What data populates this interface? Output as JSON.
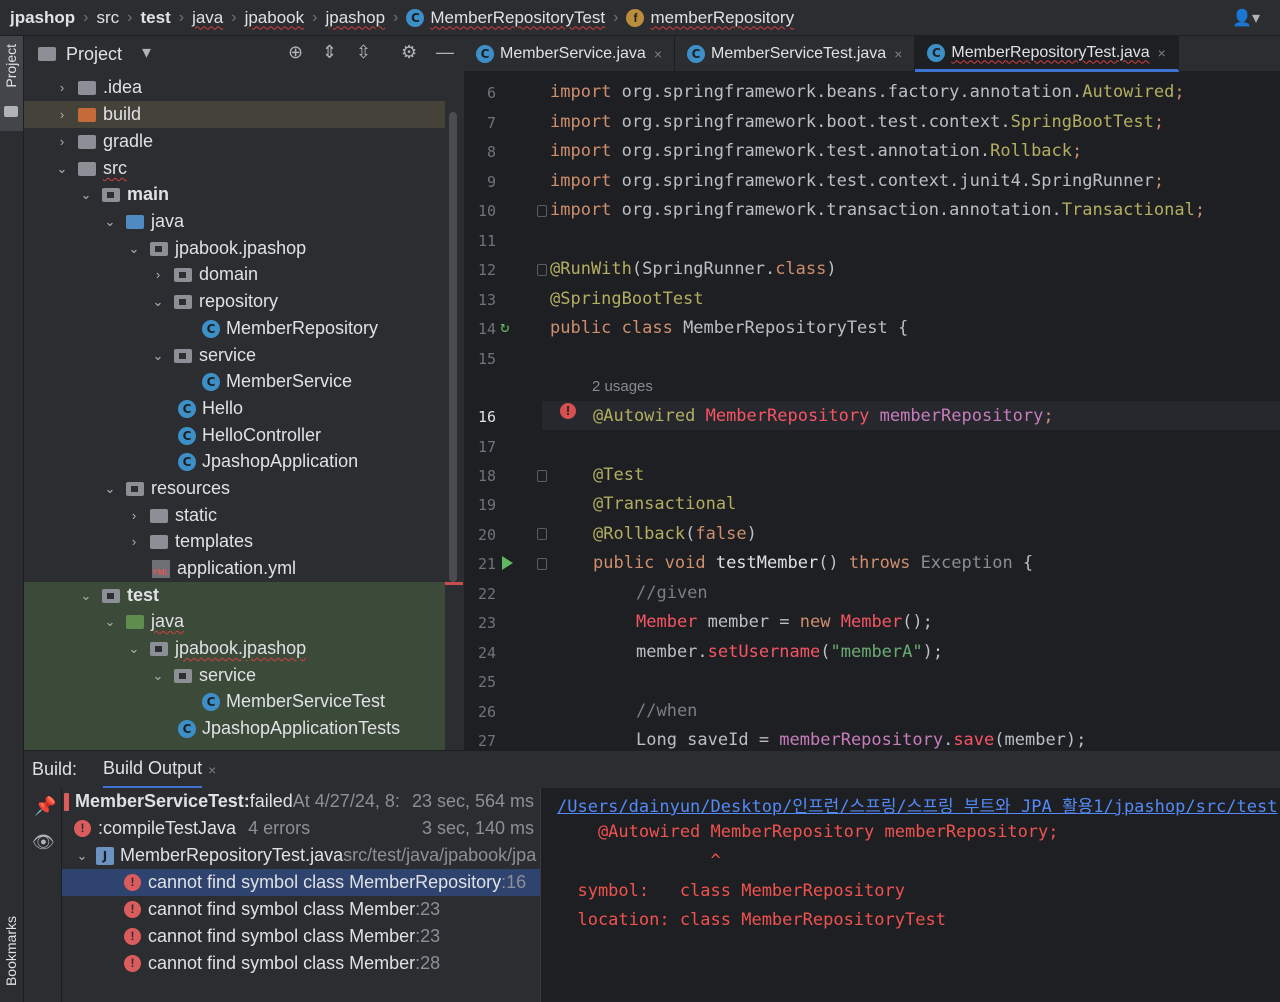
{
  "breadcrumb": [
    "jpashop",
    "src",
    "test",
    "java",
    "jpabook",
    "jpashop",
    "MemberRepositoryTest",
    "memberRepository"
  ],
  "stripe": {
    "project_tab": "Project",
    "bookmarks_tab": "Bookmarks"
  },
  "project": {
    "title": "Project",
    "tree": [
      {
        "label": ".idea",
        "arrow": "›"
      },
      {
        "label": "build",
        "arrow": "›"
      },
      {
        "label": "gradle",
        "arrow": "›"
      },
      {
        "label": "src",
        "arrow": "⌄"
      },
      {
        "label": "main",
        "arrow": "⌄"
      },
      {
        "label": "java",
        "arrow": "⌄"
      },
      {
        "label": "jpabook.jpashop",
        "arrow": "⌄"
      },
      {
        "label": "domain",
        "arrow": "›"
      },
      {
        "label": "repository",
        "arrow": "⌄"
      },
      {
        "label": "MemberRepository",
        "icon": "C"
      },
      {
        "label": "service",
        "arrow": "⌄"
      },
      {
        "label": "MemberService",
        "icon": "C"
      },
      {
        "label": "Hello",
        "icon": "C"
      },
      {
        "label": "HelloController",
        "icon": "C"
      },
      {
        "label": "JpashopApplication",
        "icon": "C"
      },
      {
        "label": "resources",
        "arrow": "⌄"
      },
      {
        "label": "static",
        "arrow": "›"
      },
      {
        "label": "templates",
        "arrow": "›"
      },
      {
        "label": "application.yml",
        "icon": "YML"
      },
      {
        "label": "test",
        "arrow": "⌄"
      },
      {
        "label": "java",
        "arrow": "⌄"
      },
      {
        "label": "jpabook.jpashop",
        "arrow": "⌄"
      },
      {
        "label": "service",
        "arrow": "⌄"
      },
      {
        "label": "MemberServiceTest",
        "icon": "C"
      },
      {
        "label": "JpashopApplicationTests",
        "icon": "C"
      }
    ]
  },
  "tabs": [
    {
      "label": "MemberService.java",
      "close": "×"
    },
    {
      "label": "MemberServiceTest.java",
      "close": "×"
    },
    {
      "label": "MemberRepositoryTest.java",
      "close": "×"
    }
  ],
  "editor": {
    "line_numbers": [
      "6",
      "7",
      "8",
      "9",
      "10",
      "11",
      "12",
      "13",
      "14",
      "15",
      "16",
      "17",
      "18",
      "19",
      "20",
      "21",
      "22",
      "23",
      "24",
      "25",
      "26",
      "27"
    ],
    "usages_hint": "2 usages",
    "lines": {
      "l6": [
        "import ",
        "org.springframework.beans.factory.annotation.",
        "Autowired",
        ";"
      ],
      "l7": [
        "import ",
        "org.springframework.boot.test.context.",
        "SpringBootTest",
        ";"
      ],
      "l8": [
        "import ",
        "org.springframework.test.annotation.",
        "Rollback",
        ";"
      ],
      "l9": [
        "import ",
        "org.springframework.test.context.junit4.SpringRunner",
        ";"
      ],
      "l10": [
        "import ",
        "org.springframework.transaction.annotation.",
        "Transactional",
        ";"
      ],
      "l12": [
        "@RunWith",
        "(SpringRunner.",
        "class",
        ")"
      ],
      "l13": [
        "@SpringBootTest"
      ],
      "l14": [
        "public class ",
        "MemberRepositoryTest {"
      ],
      "l16": [
        "@Autowired ",
        "MemberRepository",
        " ",
        "memberRepository",
        ";"
      ],
      "l18": [
        "@Test"
      ],
      "l19": [
        "@Transactional"
      ],
      "l20": [
        "@Rollback",
        "(",
        "false",
        ")"
      ],
      "l21": [
        "public void ",
        "testMember",
        "() ",
        "throws ",
        "Exception",
        " {"
      ],
      "l22": [
        "//given"
      ],
      "l23": [
        "Member",
        " member = ",
        "new ",
        "Member",
        "();"
      ],
      "l24": [
        "member.",
        "setUsername",
        "(",
        "\"memberA\"",
        ");"
      ],
      "l26": [
        "//when"
      ],
      "l27": [
        "Long saveId = ",
        "memberRepository",
        ".",
        "save",
        "(member);"
      ]
    }
  },
  "build": {
    "label": "Build:",
    "tab": "Build Output",
    "tab_close": "×",
    "rows": [
      {
        "main": "MemberServiceTest:",
        "rest": " failed",
        "extra": " At 4/27/24, 8:",
        "time": "23 sec, 564 ms"
      },
      {
        "main": ":compileTestJava",
        "extra": "4 errors",
        "time": "3 sec, 140 ms"
      },
      {
        "main": "MemberRepositoryTest.java",
        "extra": " src/test/java/jpabook/jpa"
      },
      {
        "main": "cannot find symbol class MemberRepository",
        "extra": " :16"
      },
      {
        "main": "cannot find symbol class Member",
        "extra": " :23"
      },
      {
        "main": "cannot find symbol class Member",
        "extra": " :23"
      },
      {
        "main": "cannot find symbol class Member",
        "extra": " :28"
      }
    ],
    "console": [
      "/Users/dainyun/Desktop/인프런/스프링/스프링 부트와 JPA 활용1/jpashop/src/test",
      "    @Autowired MemberRepository memberRepository;",
      "               ^",
      "  symbol:   class MemberRepository",
      "  location: class MemberRepositoryTest"
    ]
  }
}
